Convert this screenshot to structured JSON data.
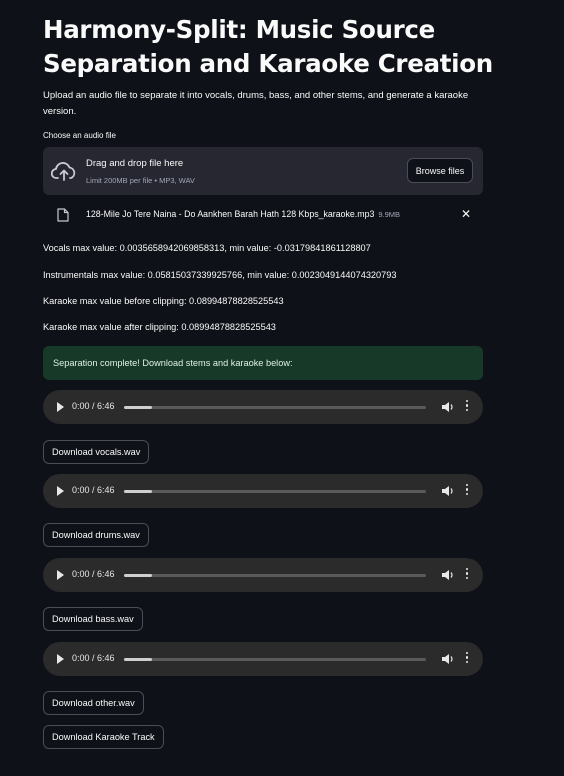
{
  "title": "Harmony-Split: Music Source Separation and Karaoke Creation",
  "description": "Upload an audio file to separate it into vocals, drums, bass, and other stems, and generate a karaoke version.",
  "uploader": {
    "label": "Choose an audio file",
    "drag_text": "Drag and drop file here",
    "limit_text": "Limit 200MB per file • MP3, WAV",
    "browse_label": "Browse files",
    "file_name": "128-Mile Jo Tere Naina - Do Aankhen Barah Hath 128 Kbps_karaoke.mp3",
    "file_size": "9.9MB"
  },
  "stats": [
    "Vocals max value: 0.0035658942069858313, min value: -0.03179841861128807",
    "Instrumentals max value: 0.05815037339925766, min value: 0.0023049144074320793",
    "Karaoke max value before clipping: 0.08994878828525543",
    "Karaoke max value after clipping: 0.08994878828525543"
  ],
  "success_message": "Separation complete! Download stems and karaoke below:",
  "players": [
    {
      "time": "0:00 / 6:46",
      "progress": 0.0
    },
    {
      "time": "0:00 / 6:46",
      "progress": 0.0
    },
    {
      "time": "0:00 / 6:46",
      "progress": 0.0
    },
    {
      "time": "0:00 / 6:46",
      "progress": 0.0
    }
  ],
  "downloads": {
    "vocals": "Download vocals.wav",
    "drums": "Download drums.wav",
    "bass": "Download bass.wav",
    "other": "Download other.wav",
    "karaoke": "Download Karaoke Track"
  },
  "colors": {
    "background": "#0e1117",
    "surface": "#262730",
    "success_bg": "#173928",
    "player_bg": "#2b2b2b"
  },
  "icons": {
    "upload": "cloud-upload-icon",
    "file": "file-icon",
    "remove": "close-icon",
    "play": "play-icon",
    "volume": "volume-icon",
    "more": "more-vertical-icon"
  }
}
